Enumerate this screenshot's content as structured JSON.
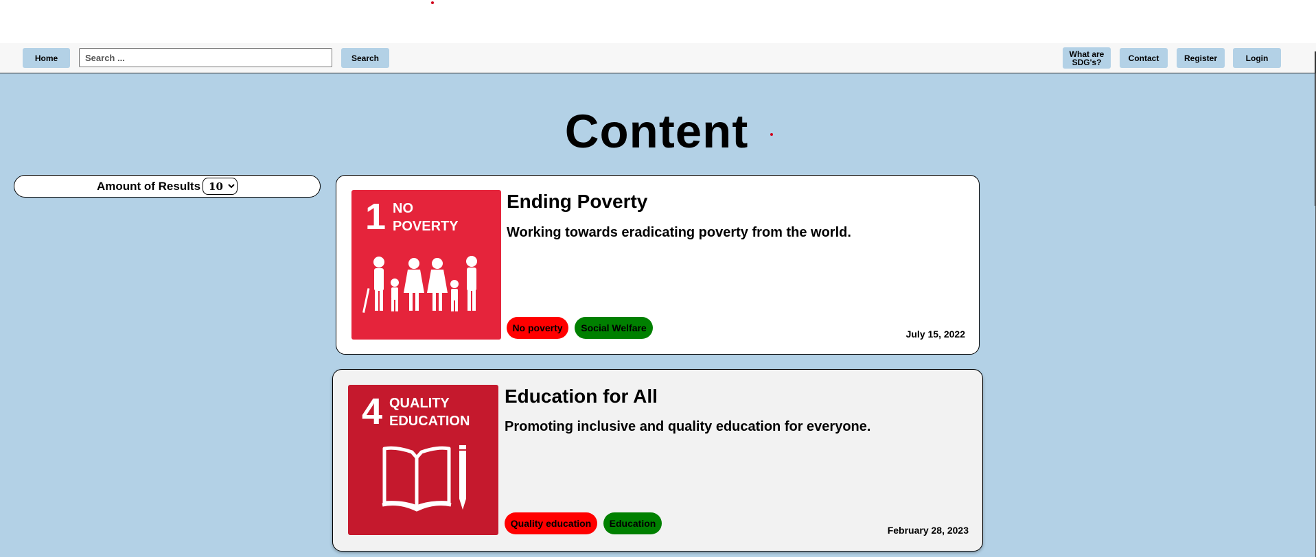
{
  "nav": {
    "home_label": "Home",
    "search_placeholder": "Search ...",
    "search_label": "Search",
    "sdgs_label_line1": "What are",
    "sdgs_label_line2": "SDG's?",
    "contact_label": "Contact",
    "register_label": "Register",
    "login_label": "Login"
  },
  "page_title": "Content",
  "filter": {
    "label": "Amount of Results",
    "selected": "10",
    "options": [
      "10"
    ]
  },
  "cards": [
    {
      "sdg_number": "1",
      "sdg_line1": "NO",
      "sdg_line2": "POVERTY",
      "sdg_color": "#e5243b",
      "icon": "family-icon",
      "title": "Ending Poverty",
      "description": "Working towards eradicating poverty from the world.",
      "tags": [
        {
          "label": "No poverty",
          "color": "#ff0000"
        },
        {
          "label": "Social Welfare",
          "color": "#008000"
        }
      ],
      "date": "July 15, 2022"
    },
    {
      "sdg_number": "4",
      "sdg_line1": "QUALITY",
      "sdg_line2": "EDUCATION",
      "sdg_color": "#c5192d",
      "icon": "book-pencil-icon",
      "title": "Education for All",
      "description": "Promoting inclusive and quality education for everyone.",
      "tags": [
        {
          "label": "Quality education",
          "color": "#ff0000"
        },
        {
          "label": "Education",
          "color": "#008000"
        }
      ],
      "date": "February 28, 2023"
    }
  ]
}
